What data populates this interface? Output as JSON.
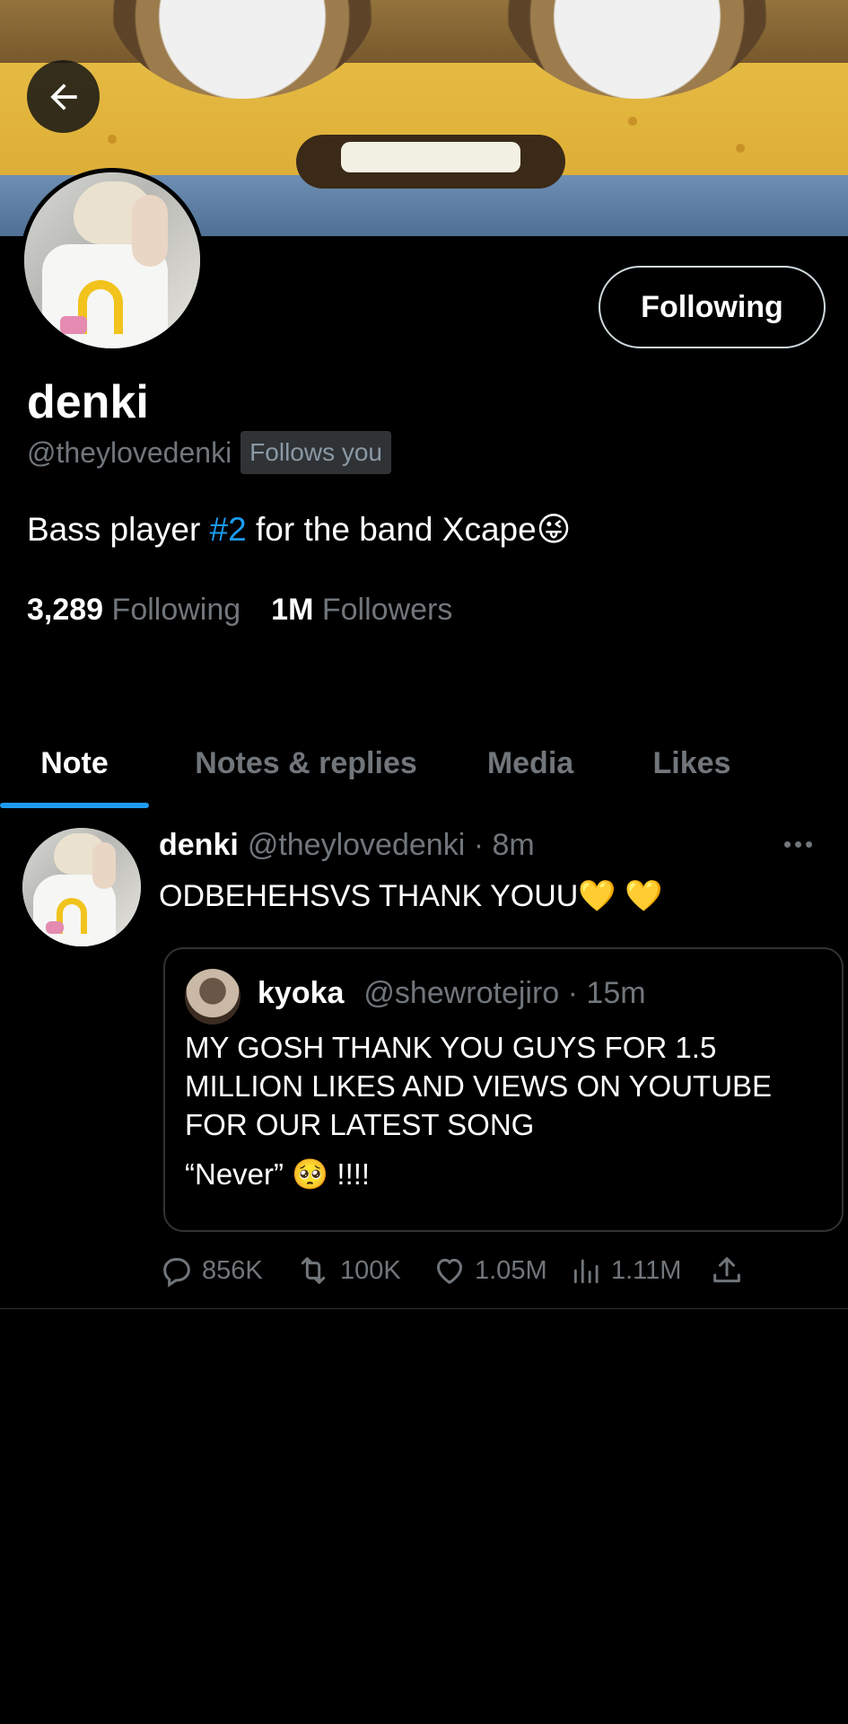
{
  "profile": {
    "name": "denki",
    "handle": "@theylovedenki",
    "follows_you": "Follows you",
    "following_button": "Following",
    "bio_before": "Bass player ",
    "bio_tag": "#2",
    "bio_after": " for the band Xcape😜",
    "following_count": "3,289",
    "following_label": "Following",
    "followers_count": "1M",
    "followers_label": "Followers"
  },
  "tabs": [
    {
      "label": "Note",
      "active": true
    },
    {
      "label": "Notes & replies",
      "active": false
    },
    {
      "label": "Media",
      "active": false
    },
    {
      "label": "Likes",
      "active": false
    }
  ],
  "post": {
    "name": "denki",
    "meta": "@theylovedenki · 8m",
    "text": "ODBEHEHSVS THANK YOUU💛 💛",
    "quote": {
      "name": "kyoka",
      "meta": "@shewrotejiro · 15m",
      "text": "MY GOSH THANK YOU GUYS FOR 1.5 MILLION LIKES AND VIEWS ON YOUTUBE FOR OUR LATEST SONG",
      "text_last": "“Never” 🥺 !!!!"
    },
    "actions": {
      "replies": "856K",
      "reposts": "100K",
      "likes": "1.05M",
      "views": "1.11M"
    }
  },
  "colors": {
    "accent": "#1d9bf0",
    "muted": "#71767b",
    "background": "#000000"
  },
  "icons": [
    "back-arrow-icon",
    "more-icon",
    "reply-icon",
    "repost-icon",
    "like-icon",
    "views-icon",
    "share-icon"
  ]
}
